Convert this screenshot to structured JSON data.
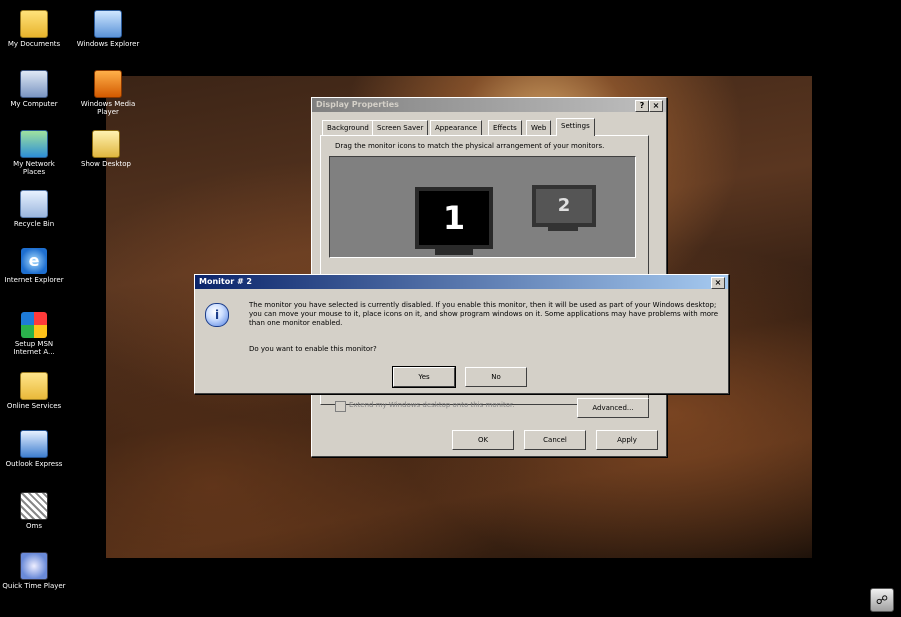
{
  "desktop_icons": [
    {
      "label": "My Documents",
      "icon": "folder-icon"
    },
    {
      "label": "Windows Explorer",
      "icon": "explorer-icon"
    },
    {
      "label": "My Computer",
      "icon": "computer-icon"
    },
    {
      "label": "Windows Media Player",
      "icon": "media-player-icon"
    },
    {
      "label": "My Network Places",
      "icon": "network-icon"
    },
    {
      "label": "Show Desktop",
      "icon": "show-desktop-icon"
    },
    {
      "label": "Recycle Bin",
      "icon": "recycle-bin-icon"
    },
    {
      "label": "Internet Explorer",
      "icon": "internet-explorer-icon"
    },
    {
      "label": "Setup MSN Internet A...",
      "icon": "msn-icon"
    },
    {
      "label": "Online Services",
      "icon": "folder-icon"
    },
    {
      "label": "Outlook Express",
      "icon": "outlook-icon"
    },
    {
      "label": "Oms",
      "icon": "oms-icon"
    },
    {
      "label": "Quick Time Player",
      "icon": "quicktime-icon"
    }
  ],
  "display_properties": {
    "title": "Display Properties",
    "help_glyph": "?",
    "close_glyph": "×",
    "tabs": [
      "Background",
      "Screen Saver",
      "Appearance",
      "Effects",
      "Web",
      "Settings"
    ],
    "active_tab": "Settings",
    "instruction": "Drag the monitor icons to match the physical arrangement of your monitors.",
    "monitor1": "1",
    "monitor2": "2",
    "extend_checkbox": "Extend my Windows desktop onto this monitor.",
    "advanced_button": "Advanced...",
    "ok_button": "OK",
    "cancel_button": "Cancel",
    "apply_button": "Apply"
  },
  "monitor_dialog": {
    "title": "Monitor # 2",
    "close_glyph": "×",
    "message": "The monitor you have selected is currently disabled. If you enable this monitor, then it will be used as part of your Windows desktop; you can move your mouse to it, place icons on it, and show program windows on it. Some applications may have problems with more than one monitor enabled.",
    "question": "Do you want to enable this monitor?",
    "yes_button": "Yes",
    "no_button": "No",
    "info_glyph": "i"
  },
  "tray": {
    "icon": "display-settings-tray-icon"
  },
  "colors": {
    "title_active": "#0a246a",
    "title_inactive": "#808080",
    "face": "#d4d0c8"
  }
}
